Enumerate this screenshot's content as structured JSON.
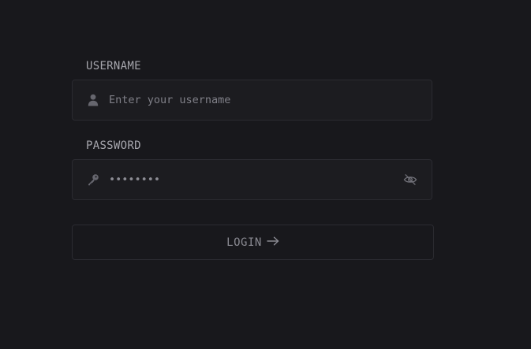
{
  "username": {
    "label": "USERNAME",
    "placeholder": "Enter your username",
    "icon": "user-icon"
  },
  "password": {
    "label": "PASSWORD",
    "value": "********",
    "icon": "key-icon",
    "toggle_icon": "eye-off-icon"
  },
  "login": {
    "label": "LOGIN",
    "icon": "arrow-right-icon"
  },
  "colors": {
    "background": "#18181c",
    "field_background": "#1c1c20",
    "border": "#2b2b31",
    "text": "#9a9aa2"
  }
}
